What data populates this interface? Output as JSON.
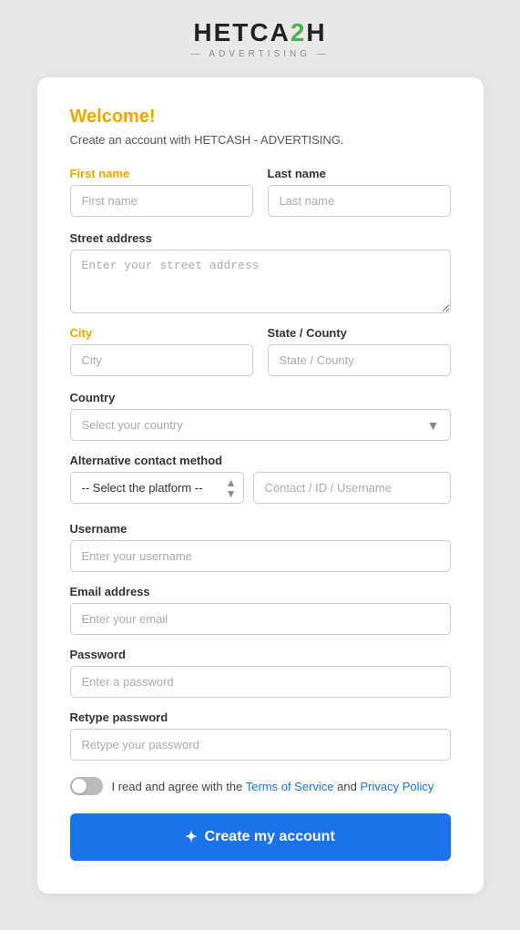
{
  "logo": {
    "text_before": "HETCA",
    "text_highlight": "2",
    "text_after": "H",
    "subtitle": "— ADVERTISING —"
  },
  "card": {
    "welcome_title": "Welcome!",
    "welcome_sub": "Create an account with HETCASH - ADVERTISING.",
    "first_name_label": "First name",
    "first_name_placeholder": "First name",
    "last_name_label": "Last name",
    "last_name_placeholder": "Last name",
    "street_address_label": "Street address",
    "street_address_placeholder": "Enter your street address",
    "city_label": "City",
    "city_placeholder": "City",
    "state_county_label": "State / County",
    "state_county_placeholder": "State / County",
    "country_label": "Country",
    "country_placeholder": "Select your country",
    "alt_contact_label": "Alternative contact method",
    "platform_placeholder": "-- Select the platform --",
    "contact_placeholder": "Contact / ID / Username",
    "username_label": "Username",
    "username_placeholder": "Enter your username",
    "email_label": "Email address",
    "email_placeholder": "Enter your email",
    "password_label": "Password",
    "password_placeholder": "Enter a password",
    "retype_password_label": "Retype password",
    "retype_password_placeholder": "Retype your password",
    "terms_text_before": "I read and agree with the",
    "terms_link1": "Terms of Service",
    "terms_text_and": "and",
    "terms_link2": "Privacy Policy",
    "create_btn_label": "Create my account"
  }
}
